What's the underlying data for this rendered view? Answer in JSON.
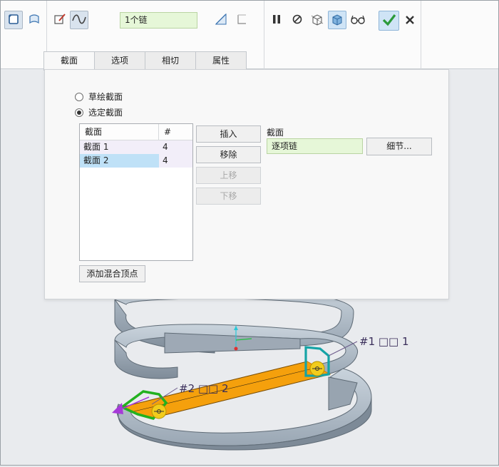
{
  "toolbar": {
    "icons": [
      "solid-icon",
      "surface-icon",
      "sketch-icon",
      "spline-icon",
      "thicken-icon",
      "remove-icon",
      "pause-icon",
      "no-preview-icon",
      "geometry-preview-icon",
      "verify-icon",
      "glasses-icon",
      "confirm-icon",
      "cancel-icon"
    ],
    "chain_field_value": "1个链"
  },
  "tabs": [
    {
      "label": "截面"
    },
    {
      "label": "选项"
    },
    {
      "label": "相切"
    },
    {
      "label": "属性"
    }
  ],
  "panel": {
    "radio_sketched": "草绘截面",
    "radio_selected": "选定截面",
    "list_headers": [
      "截面",
      "#"
    ],
    "rows": [
      {
        "name": "截面 1",
        "count": "4"
      },
      {
        "name": "截面 2",
        "count": "4"
      }
    ],
    "insert_label": "插入",
    "remove_label": "移除",
    "up_label": "上移",
    "down_label": "下移",
    "section_label": "截面",
    "section_value": "逐项链",
    "details_label": "细节...",
    "add_blend_vertex_label": "添加混合顶点"
  },
  "viewport": {
    "annotation_1": "#1 □□ 1",
    "annotation_2": "#2 □□ 2",
    "colors": {
      "coil": "#a7b3bf",
      "highlight": "#f5a00c",
      "section_1": "#15a3a6",
      "section_2": "#23b11f",
      "handle": "#f2cc1c",
      "arrow": "#a63ad8"
    }
  }
}
